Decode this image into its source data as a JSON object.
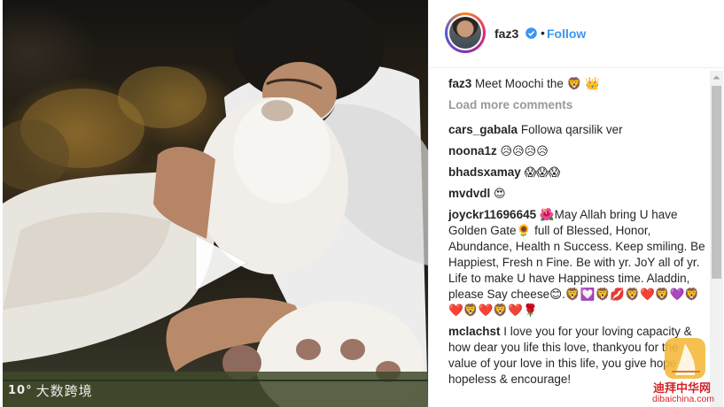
{
  "post": {
    "username": "faz3",
    "follow_label": "Follow",
    "separator": "•",
    "caption_user": "faz3",
    "caption_text": "Meet Moochi the 🦁 👑",
    "load_more": "Load more comments"
  },
  "comments": [
    {
      "user": "cars_gabala",
      "text": "Followa qarsilik ver"
    },
    {
      "user": "noona1z",
      "text": "😥😥😥😥"
    },
    {
      "user": "bhadsxamay",
      "text": "😱😱😱"
    },
    {
      "user": "mvdvdl",
      "text": "😍"
    },
    {
      "user": "joyckr11696645",
      "text": "🌺May Allah bring U have Golden Gate🌻 full of Blessed, Honor, Abundance, Health n Success. Keep smiling. Be Happiest, Fresh n Fine. Be with yr. JoY all of yr. Life to make U have Happiness time. Aladdin, please Say cheese😊.🦁💟🦁💋🦁❤️🦁💜🦁❤️🦁❤️🦁❤️🌹"
    },
    {
      "user": "mclachst",
      "text": "I love you for your loving capacity & how dear you life this love, thankyou for the value of your love in this life, you give hope to hopeless & encourage!"
    }
  ],
  "media": {
    "watermark_text": "大数跨境",
    "watermark_mark": "10°"
  },
  "site_watermark": {
    "text": "迪拜中华网",
    "url": "dibaichina.com"
  },
  "colors": {
    "accent": "#3897f0",
    "text": "#262626",
    "muted": "#999999",
    "watermark_red": "#d4242a"
  },
  "icons": [
    "verified-badge-icon",
    "play-icon",
    "scroll-up-arrow-icon"
  ]
}
